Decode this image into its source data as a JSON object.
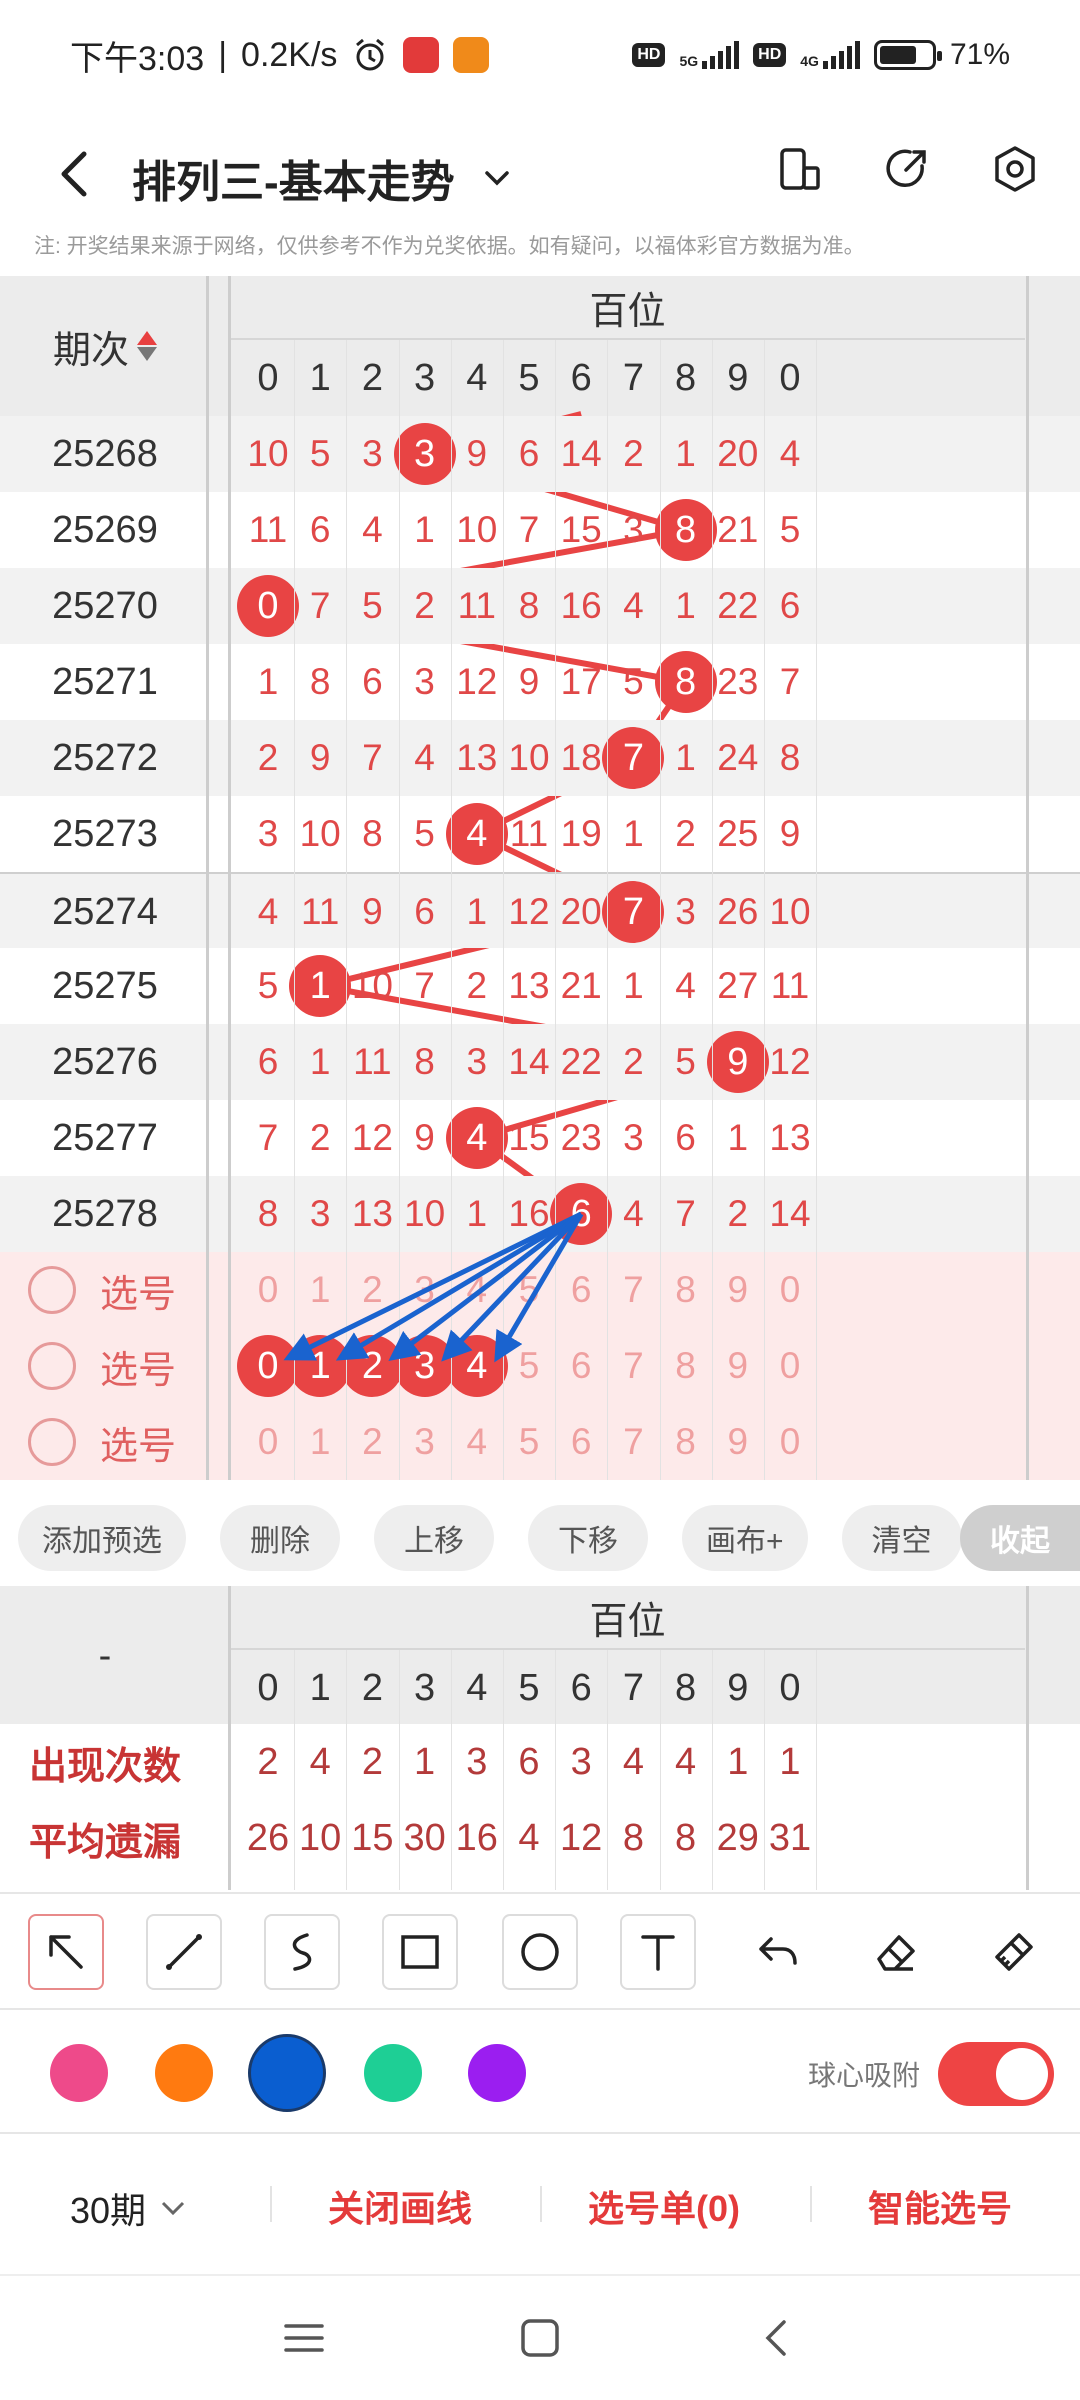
{
  "status_bar": {
    "time": "下午3:03",
    "speed": "0.2K/s",
    "hd1": "HD",
    "net1": "5G",
    "hd2": "HD",
    "net2": "4G",
    "battery": "71%",
    "battery_level": 0.71
  },
  "nav": {
    "title": "排列三-基本走势"
  },
  "note": "注: 开奖结果来源于网络，仅供参考不作为兑奖依据。如有疑问，以福体彩官方数据为准。",
  "trend": {
    "period_header": "期次",
    "group_header": "百位",
    "digits": [
      "0",
      "1",
      "2",
      "3",
      "4",
      "5",
      "6",
      "7",
      "8",
      "9",
      "0"
    ],
    "rows": [
      {
        "period": "25268",
        "values": [
          "10",
          "5",
          "3",
          "3",
          "9",
          "6",
          "14",
          "2",
          "1",
          "20",
          "4"
        ],
        "ball": 3
      },
      {
        "period": "25269",
        "values": [
          "11",
          "6",
          "4",
          "1",
          "10",
          "7",
          "15",
          "3",
          "8",
          "21",
          "5"
        ],
        "ball": 8
      },
      {
        "period": "25270",
        "values": [
          "0",
          "7",
          "5",
          "2",
          "11",
          "8",
          "16",
          "4",
          "1",
          "22",
          "6"
        ],
        "ball": 0
      },
      {
        "period": "25271",
        "values": [
          "1",
          "8",
          "6",
          "3",
          "12",
          "9",
          "17",
          "5",
          "8",
          "23",
          "7"
        ],
        "ball": 8
      },
      {
        "period": "25272",
        "values": [
          "2",
          "9",
          "7",
          "4",
          "13",
          "10",
          "18",
          "7",
          "1",
          "24",
          "8"
        ],
        "ball": 7
      },
      {
        "period": "25273",
        "values": [
          "3",
          "10",
          "8",
          "5",
          "4",
          "11",
          "19",
          "1",
          "2",
          "25",
          "9"
        ],
        "ball": 4
      },
      {
        "period": "25274",
        "values": [
          "4",
          "11",
          "9",
          "6",
          "1",
          "12",
          "20",
          "7",
          "3",
          "26",
          "10"
        ],
        "ball": 7
      },
      {
        "period": "25275",
        "values": [
          "5",
          "1",
          "10",
          "7",
          "2",
          "13",
          "21",
          "1",
          "4",
          "27",
          "11"
        ],
        "ball": 1
      },
      {
        "period": "25276",
        "values": [
          "6",
          "1",
          "11",
          "8",
          "3",
          "14",
          "22",
          "2",
          "5",
          "9",
          "12"
        ],
        "ball": 9
      },
      {
        "period": "25277",
        "values": [
          "7",
          "2",
          "12",
          "9",
          "4",
          "15",
          "23",
          "3",
          "6",
          "1",
          "13"
        ],
        "ball": 4
      },
      {
        "period": "25278",
        "values": [
          "8",
          "3",
          "13",
          "10",
          "1",
          "16",
          "6",
          "4",
          "7",
          "2",
          "14"
        ],
        "ball": 6
      }
    ],
    "pick_label": "选号",
    "pick_values": [
      "0",
      "1",
      "2",
      "3",
      "4",
      "5",
      "6",
      "7",
      "8",
      "9",
      "0"
    ],
    "selected_second_row": [
      0,
      1,
      2,
      3,
      4
    ]
  },
  "actions": {
    "add": "添加预选",
    "delete": "删除",
    "up": "上移",
    "down": "下移",
    "canvas": "画布+",
    "clear": "清空",
    "collapse": "收起"
  },
  "stats": {
    "label_dash": "-",
    "group_header": "百位",
    "digits": [
      "0",
      "1",
      "2",
      "3",
      "4",
      "5",
      "6",
      "7",
      "8",
      "9",
      "0"
    ],
    "appear_label": "出现次数",
    "appear": [
      "2",
      "4",
      "2",
      "1",
      "3",
      "6",
      "3",
      "4",
      "4",
      "1",
      "1"
    ],
    "miss_label": "平均遗漏",
    "miss": [
      "26",
      "10",
      "15",
      "30",
      "16",
      "4",
      "12",
      "8",
      "8",
      "29",
      "31"
    ]
  },
  "tools": [
    "arrow-tool-icon",
    "line-tool-icon",
    "curve-tool-icon",
    "rect-tool-icon",
    "circle-tool-icon",
    "text-tool-icon",
    "undo-icon",
    "eraser-icon",
    "clear-canvas-icon"
  ],
  "colors": {
    "pink": "#ee4a8a",
    "orange": "#ff7a10",
    "blue": "#0a5ed0",
    "green": "#1ecf95",
    "purple": "#9b1ef0",
    "selected": "blue",
    "ball_red": "#e84444",
    "arrow_blue": "#1a63cf"
  },
  "snap": {
    "label": "球心吸附",
    "on": true
  },
  "bottom": {
    "periods": "30期",
    "close_lines": "关闭画线",
    "pick_list": "选号单(0)",
    "smart_pick": "智能选号"
  }
}
